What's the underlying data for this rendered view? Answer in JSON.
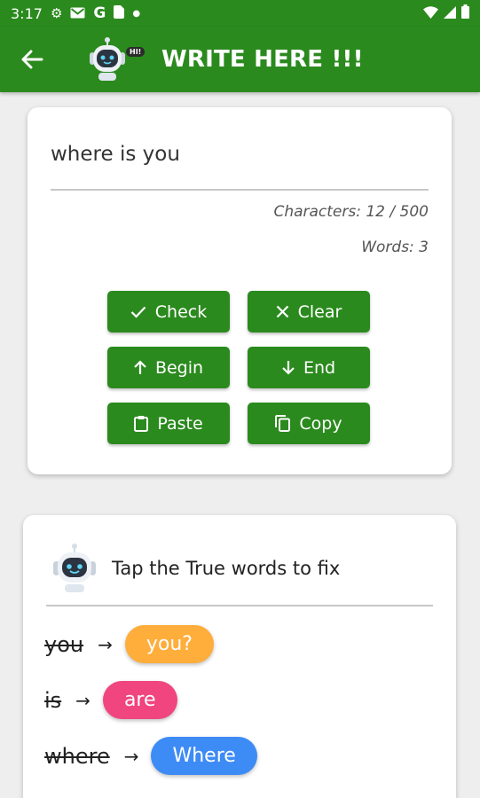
{
  "status_bar": {
    "time": "3:17",
    "color": "#2b8a1e"
  },
  "app_bar": {
    "title": "WRITE HERE !!!",
    "logo_badge": "HI!",
    "color": "#2b8a1e"
  },
  "editor": {
    "text_value": "where is you",
    "characters_text": "Characters: 12 / 500",
    "words_text": "Words: 3"
  },
  "buttons": {
    "check": "Check",
    "clear": "Clear",
    "begin": "Begin",
    "end": "End",
    "paste": "Paste",
    "copy": "Copy"
  },
  "fix_card": {
    "title": "Tap the True words to fix",
    "suggestions": [
      {
        "wrong": "you",
        "arrow": "→",
        "fix": "you?",
        "color": "#ffad3b"
      },
      {
        "wrong": "is",
        "arrow": "→",
        "fix": "are",
        "color": "#f0457e"
      },
      {
        "wrong": "where",
        "arrow": "→",
        "fix": "Where",
        "color": "#3d8bf5"
      }
    ]
  },
  "icons": {
    "status": [
      "gear-icon",
      "gmail-icon",
      "google-icon",
      "sim-icon",
      "dot-icon",
      "wifi-icon",
      "signal-icon",
      "battery-icon"
    ],
    "toolbar": [
      "back-arrow-icon",
      "robot-logo-icon"
    ],
    "buttons": [
      "check-icon",
      "close-icon",
      "arrow-up-icon",
      "arrow-down-icon",
      "clipboard-icon",
      "copy-icon"
    ]
  }
}
